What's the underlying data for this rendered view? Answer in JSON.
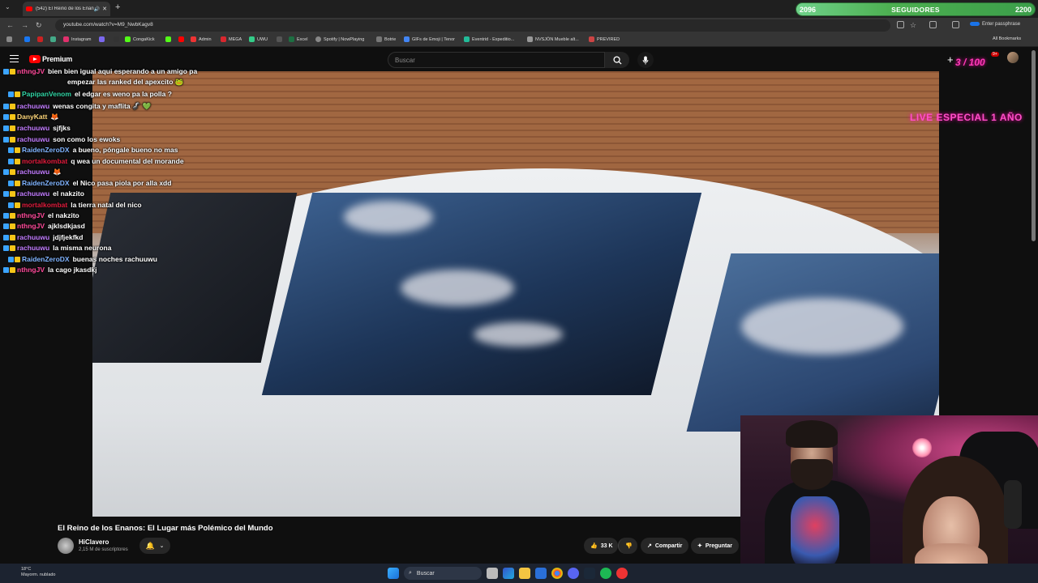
{
  "browser": {
    "tab_title": "(542) El Reino de los Enanos: El Lugar más Polémico del Mundo",
    "url": "youtube.com/watch?v=M9_NwbKagv8",
    "passphrase_label": "Enter passphrase",
    "all_bookmarks": "All Bookmarks",
    "bookmarks": [
      "Instagram",
      "CongaKick",
      "Admin",
      "MEGA",
      "UWU",
      "Excel",
      "Spotify | NowPlaying",
      "Botrie",
      "GIFs de Emoji | Tenor",
      "Eventrid - Expeditio...",
      "NVSJÖN Mueble alt...",
      "PREVIRED"
    ]
  },
  "follow_goal": {
    "current": "2096",
    "label": "SEGUIDORES",
    "target": "2200"
  },
  "youtube": {
    "logo_text": "Premium",
    "search_placeholder": "Buscar",
    "notif_count": "9+",
    "video_title": "El Reino de los Enanos: El Lugar más Polémico del Mundo",
    "channel_name": "HiClavero",
    "channel_subs": "2,15 M de suscriptores",
    "likes": "33 K",
    "share_label": "Compartir",
    "ask_label": "Preguntar"
  },
  "stream_overlay": {
    "counter_text": "3 / 100",
    "live_text": "LIVE ESPECIAL 1 AÑO"
  },
  "chat": [
    {
      "user": "nthngJV",
      "color": "#ff4a9a",
      "text": "bien bien igual aqui esperando a un amigo pa"
    },
    {
      "user": "",
      "color": "#ff4a9a",
      "text": "empezar las ranked del apexcito 🐸"
    },
    {
      "user": "PapipanVenom",
      "color": "#2fd3a3",
      "text": "el edgar es weno pa la polla ?"
    },
    {
      "user": "rachuuwu",
      "color": "#c27cff",
      "text": "wenas congita y maflita 🦨 💚"
    },
    {
      "user": "DanyKatt",
      "color": "#ffd77a",
      "text": "🦊"
    },
    {
      "user": "rachuuwu",
      "color": "#c27cff",
      "text": "sjfjks"
    },
    {
      "user": "rachuuwu",
      "color": "#c27cff",
      "text": "son como los ewoks"
    },
    {
      "user": "RaidenZeroDX",
      "color": "#7fb3ff",
      "text": "a bueno, póngale bueno no mas"
    },
    {
      "user": "mortalkombat",
      "color": "#e01b3c",
      "text": "q wea un documental del morande"
    },
    {
      "user": "rachuuwu",
      "color": "#c27cff",
      "text": "🦊"
    },
    {
      "user": "RaidenZeroDX",
      "color": "#7fb3ff",
      "text": "el Nico pasa piola por alla xdd"
    },
    {
      "user": "rachuuwu",
      "color": "#c27cff",
      "text": "el nakzito"
    },
    {
      "user": "mortalkombat",
      "color": "#e01b3c",
      "text": "la tierra natal del nico"
    },
    {
      "user": "nthngJV",
      "color": "#ff4a9a",
      "text": "el nakzito"
    },
    {
      "user": "nthngJV",
      "color": "#ff4a9a",
      "text": "ajklsdkjasd"
    },
    {
      "user": "rachuuwu",
      "color": "#c27cff",
      "text": "jdjfjekfkd"
    },
    {
      "user": "rachuuwu",
      "color": "#c27cff",
      "text": "la misma neurona"
    },
    {
      "user": "RaidenZeroDX",
      "color": "#7fb3ff",
      "text": "buenas noches rachuuwu"
    },
    {
      "user": "nthngJV",
      "color": "#ff4a9a",
      "text": "la cago jkasdkj"
    }
  ],
  "taskbar": {
    "temperature": "18°C",
    "weather": "Mayorm. nublado",
    "search": "Buscar"
  }
}
